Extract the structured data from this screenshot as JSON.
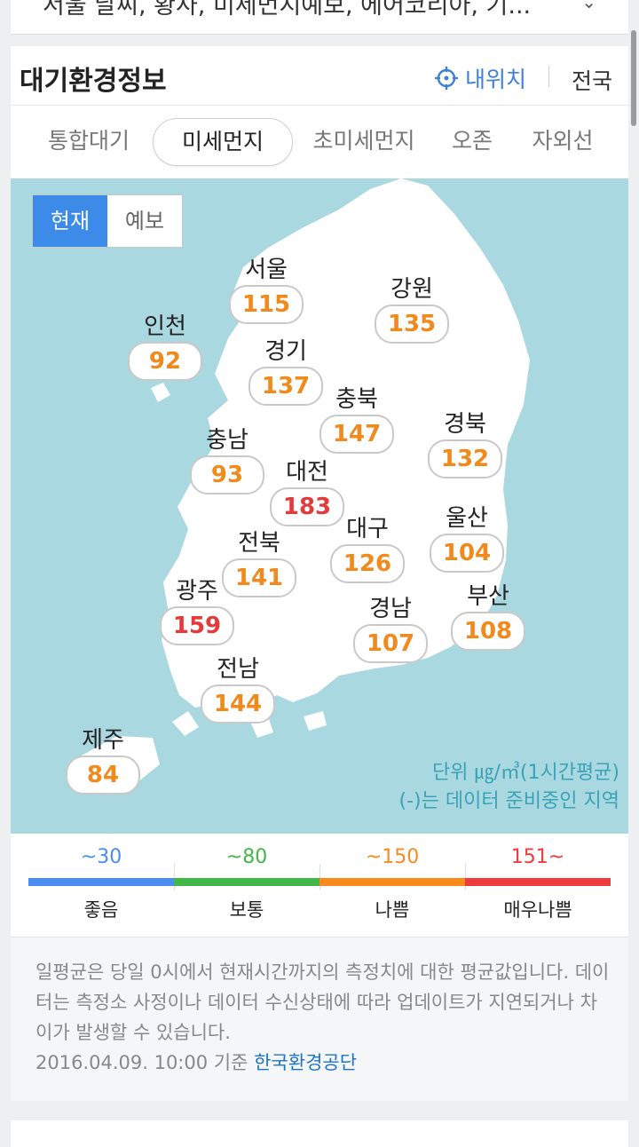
{
  "top_card": {
    "text": "서울 날씨, 황사, 미세먼지예보, 에어코리아, 기..."
  },
  "header": {
    "title": "대기환경정보",
    "my_location": "내위치",
    "nationwide": "전국"
  },
  "tabs": [
    {
      "label": "통합대기",
      "active": false
    },
    {
      "label": "미세먼지",
      "active": true
    },
    {
      "label": "초미세먼지",
      "active": false
    },
    {
      "label": "오존",
      "active": false
    },
    {
      "label": "자외선",
      "active": false
    }
  ],
  "toggle": {
    "current": "현재",
    "forecast": "예보"
  },
  "regions": [
    {
      "name": "서울",
      "value": "115",
      "level": "bad"
    },
    {
      "name": "강원",
      "value": "135",
      "level": "bad"
    },
    {
      "name": "인천",
      "value": "92",
      "level": "bad"
    },
    {
      "name": "경기",
      "value": "137",
      "level": "bad"
    },
    {
      "name": "충북",
      "value": "147",
      "level": "bad"
    },
    {
      "name": "경북",
      "value": "132",
      "level": "bad"
    },
    {
      "name": "충남",
      "value": "93",
      "level": "bad"
    },
    {
      "name": "대전",
      "value": "183",
      "level": "very-bad"
    },
    {
      "name": "전북",
      "value": "141",
      "level": "bad"
    },
    {
      "name": "대구",
      "value": "126",
      "level": "bad"
    },
    {
      "name": "울산",
      "value": "104",
      "level": "bad"
    },
    {
      "name": "광주",
      "value": "159",
      "level": "very-bad"
    },
    {
      "name": "경남",
      "value": "107",
      "level": "bad"
    },
    {
      "name": "부산",
      "value": "108",
      "level": "bad"
    },
    {
      "name": "전남",
      "value": "144",
      "level": "bad"
    },
    {
      "name": "제주",
      "value": "84",
      "level": "bad"
    }
  ],
  "unit_note": {
    "unit": "단위 ㎍/㎥(1시간평균)",
    "pending": "(-)는 데이터 준비중인 지역"
  },
  "legend": [
    {
      "range": "~30",
      "label": "좋음",
      "color": "#4b8df0"
    },
    {
      "range": "~80",
      "label": "보통",
      "color": "#43b649"
    },
    {
      "range": "~150",
      "label": "나쁨",
      "color": "#f98a1d"
    },
    {
      "range": "151~",
      "label": "매우나쁨",
      "color": "#ef3b3b"
    }
  ],
  "footer": {
    "note": "일평균은 당일 0시에서 현재시간까지의 측정치에 대한 평균값입니다. 데이터는 측정소 사정이나 데이터 수신상태에 따라 업데이트가 지연되거나 차이가 발생할 수 있습니다.",
    "timestamp": "2016.04.09. 10:00 기준",
    "source": "한국환경공단"
  },
  "colors": {
    "accent": "#3d8be8",
    "map_sea": "#a9d8e1",
    "bad": "#f08a1c",
    "very_bad": "#e53a3a"
  },
  "icons": {
    "my_location": "crosshair-icon",
    "dropdown": "chevron-down-icon"
  }
}
